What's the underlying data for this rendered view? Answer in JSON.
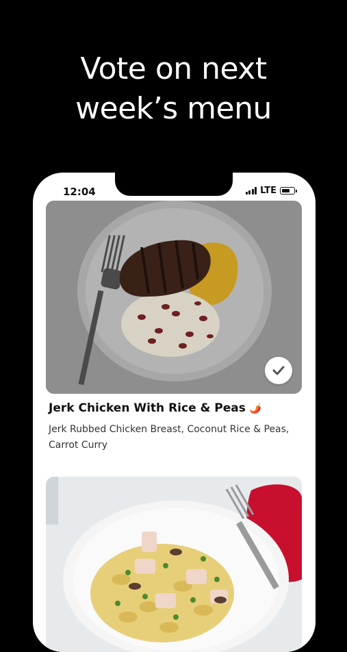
{
  "headline": {
    "line1": "Vote on next",
    "line2": "week’s menu"
  },
  "status_bar": {
    "time": "12:04",
    "network": "LTE"
  },
  "dishes": [
    {
      "title": "Jerk Chicken With Rice & Peas",
      "spice_icon": "🌶️",
      "description": "Jerk Rubbed Chicken Breast, Coconut Rice & Peas, Carrot Curry",
      "selected": true,
      "icon": "checkmark-icon"
    },
    {
      "title": "",
      "description": "",
      "selected": false
    }
  ],
  "colors": {
    "background": "#000000",
    "card": "#ffffff",
    "accent": "#d32f2f"
  }
}
